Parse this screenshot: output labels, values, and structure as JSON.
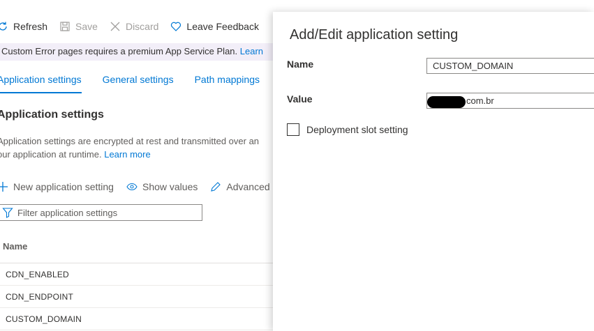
{
  "toolbar": {
    "refresh": "Refresh",
    "save": "Save",
    "discard": "Discard",
    "feedback": "Leave Feedback"
  },
  "banner": {
    "text": "Custom Error pages requires a premium App Service Plan.",
    "link": "Learn"
  },
  "tabs": [
    "Application settings",
    "General settings",
    "Path mappings"
  ],
  "section": {
    "title": "Application settings",
    "desc_line1": "Application settings are encrypted at rest and transmitted over an",
    "desc_line2": "our application at runtime.",
    "learn_more": "Learn more"
  },
  "actions": {
    "new": "New application setting",
    "show": "Show values",
    "advanced": "Advanced"
  },
  "filter": {
    "placeholder": "Filter application settings"
  },
  "table": {
    "header": "Name",
    "rows": [
      "CDN_ENABLED",
      "CDN_ENDPOINT",
      "CUSTOM_DOMAIN"
    ]
  },
  "panel": {
    "title": "Add/Edit application setting",
    "name_label": "Name",
    "name_value": "CUSTOM_DOMAIN",
    "value_label": "Value",
    "value_value": "com.br",
    "slot_label": "Deployment slot setting"
  },
  "colors": {
    "accent": "#0078d4",
    "banner_bg": "#f2eef8"
  }
}
